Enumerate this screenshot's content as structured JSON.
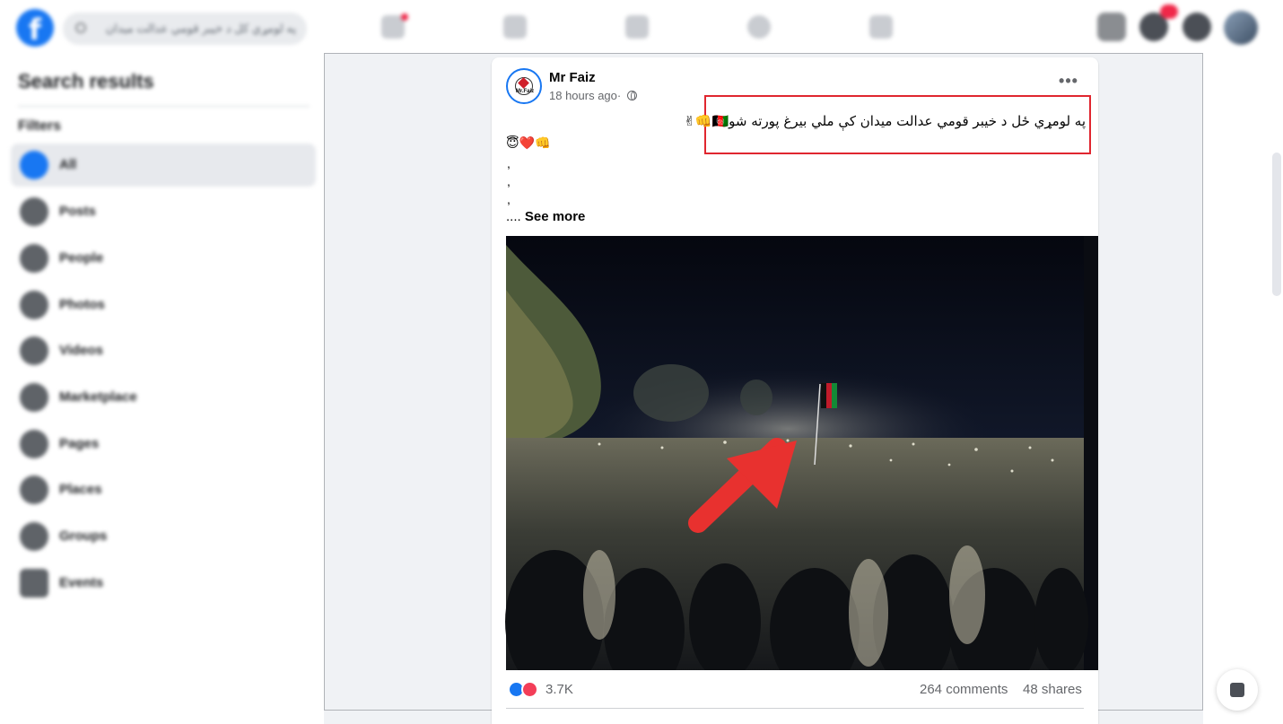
{
  "topbar": {
    "search_text": "په لومړي کل د خیبر قومي عدالت میدان"
  },
  "sidebar": {
    "title": "Search results",
    "filters_label": "Filters",
    "items": [
      {
        "label": "All"
      },
      {
        "label": "Posts"
      },
      {
        "label": "People"
      },
      {
        "label": "Photos"
      },
      {
        "label": "Videos"
      },
      {
        "label": "Marketplace"
      },
      {
        "label": "Pages"
      },
      {
        "label": "Places"
      },
      {
        "label": "Groups"
      },
      {
        "label": "Events"
      }
    ]
  },
  "post": {
    "author": "Mr Faiz",
    "avatar_text": "Mr.Faiz",
    "time": "18 hours ago",
    "time_sep": "·",
    "more": "•••",
    "text_rtl": "په لومړي ځل د خیبر قومي عدالت میدان کې ملي بیرغ پورته شو🇦🇫👊✌",
    "emoji_line": "😇❤️👊",
    "comma": ",",
    "see_more_prefix": "....",
    "see_more": "See more",
    "reactions_count": "3.7K",
    "comments": "264 comments",
    "shares": "48 shares"
  },
  "colors": {
    "brand": "#1877f2",
    "highlight": "#e0262f",
    "arrow": "#e8312f"
  }
}
